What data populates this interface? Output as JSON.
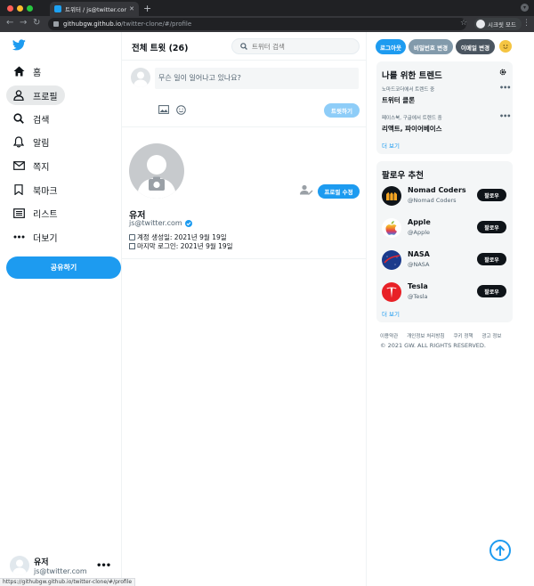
{
  "browser": {
    "tab_title": "트위터 / js@twitter.com 프로필",
    "url_host": "githubgw.github.io",
    "url_path": "/twitter-clone/#/profile",
    "profile_label": "시크릿 모드",
    "status_url": "https://githubgw.github.io/twitter-clone/#/profile"
  },
  "sidebar": {
    "items": [
      {
        "label": "홈",
        "icon": "home-icon"
      },
      {
        "label": "프로필",
        "icon": "user-icon"
      },
      {
        "label": "검색",
        "icon": "search-icon"
      },
      {
        "label": "알림",
        "icon": "bell-icon"
      },
      {
        "label": "쪽지",
        "icon": "mail-icon"
      },
      {
        "label": "북마크",
        "icon": "bookmark-icon"
      },
      {
        "label": "리스트",
        "icon": "list-icon"
      },
      {
        "label": "더보기",
        "icon": "more-icon"
      }
    ],
    "share_button": "공유하기",
    "user": {
      "name": "유저",
      "handle": "js@twitter.com"
    }
  },
  "header": {
    "title": "전체 트윗 (26)",
    "search_placeholder": "트위터 검색"
  },
  "composer": {
    "placeholder": "무슨 일이 일어나고 있나요?",
    "tweet_button": "트윗하기"
  },
  "profile": {
    "name": "유저",
    "handle": "js@twitter.com",
    "created": "계정 생성일: 2021년 9월 19일",
    "last_login": "마지막 로그인: 2021년 9월 19일",
    "edit_button": "프로필 수정"
  },
  "account_buttons": {
    "logout": "로그아웃",
    "change_password": "비밀번호 변경",
    "change_email": "이메일 변경"
  },
  "trends": {
    "title": "나를 위한 트렌드",
    "items": [
      {
        "context": "노마드코더에서 트렌드 중",
        "name": "트위터 클론"
      },
      {
        "context": "페이스북, 구글에서 트렌드 중",
        "name": "리액트, 파이어베이스"
      }
    ],
    "more": "더 보기"
  },
  "follow": {
    "title": "팔로우 추천",
    "button_label": "팔로우",
    "items": [
      {
        "name": "Nomad Coders",
        "handle": "@Nomad Coders"
      },
      {
        "name": "Apple",
        "handle": "@Apple"
      },
      {
        "name": "NASA",
        "handle": "@NASA"
      },
      {
        "name": "Tesla",
        "handle": "@Tesla"
      }
    ],
    "more": "더 보기"
  },
  "footer": {
    "links": [
      "이용약관",
      "개인정보 처리방침",
      "쿠키 정책",
      "광고 정보"
    ],
    "copyright": "© 2021 GW. ALL RIGHTS RESERVED."
  },
  "colors": {
    "accent": "#1d9bf0",
    "dark_button": "#0f1419",
    "gray_button": "#829aab"
  }
}
